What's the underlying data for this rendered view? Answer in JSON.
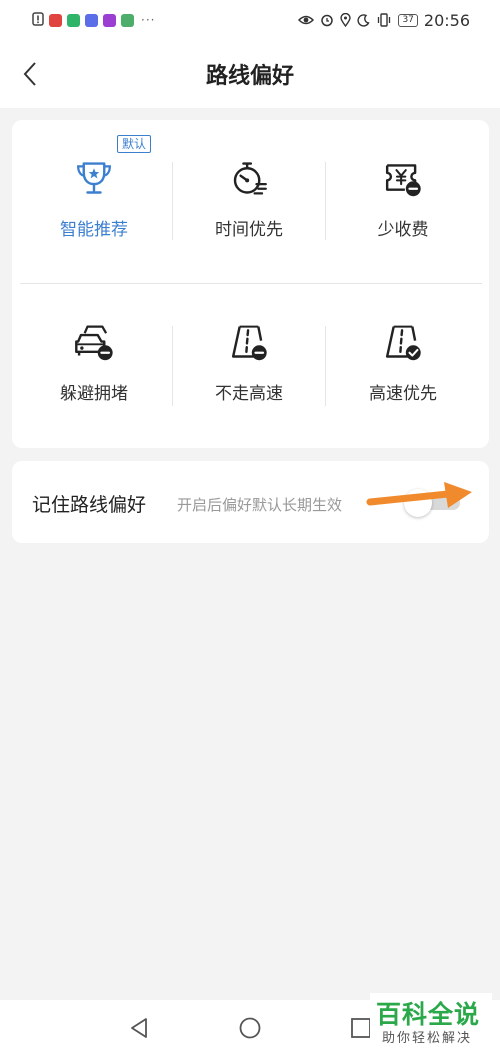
{
  "status_bar": {
    "time": "20:56",
    "battery": "37",
    "more": "···",
    "app_icons": [
      "#e0443e",
      "#f0a020",
      "#2fb56a",
      "#5b6ee8",
      "#9b3fd3",
      "#4cae6a"
    ]
  },
  "header": {
    "title": "路线偏好"
  },
  "route_options": {
    "default_badge": "默认",
    "items": [
      {
        "label": "智能推荐",
        "icon": "trophy-icon",
        "selected": true
      },
      {
        "label": "时间优先",
        "icon": "stopwatch-icon",
        "selected": false
      },
      {
        "label": "少收费",
        "icon": "toll-ticket-icon",
        "selected": false
      },
      {
        "label": "躲避拥堵",
        "icon": "car-traffic-icon",
        "selected": false
      },
      {
        "label": "不走高速",
        "icon": "road-minus-icon",
        "selected": false
      },
      {
        "label": "高速优先",
        "icon": "road-check-icon",
        "selected": false
      }
    ]
  },
  "remember": {
    "title": "记住路线偏好",
    "subtitle": "开启后偏好默认长期生效",
    "enabled": false
  },
  "watermark": {
    "title": "百科全说",
    "subtitle": "助你轻松解决"
  },
  "colors": {
    "accent": "#3d7fcf",
    "arrow": "#f08a2c",
    "watermark_green": "#2aa84a"
  }
}
